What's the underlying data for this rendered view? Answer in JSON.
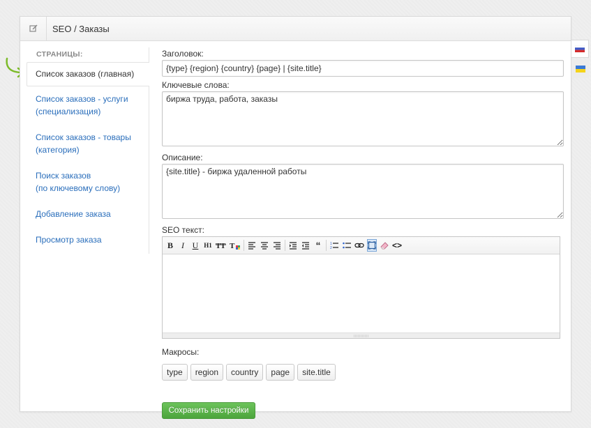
{
  "header": {
    "title": "SEO / Заказы",
    "icon": "edit-icon"
  },
  "sidebar": {
    "title": "СТРАНИЦЫ:",
    "active_item": "Список заказов (главная)",
    "items": [
      {
        "line1": "Список заказов - услуги",
        "line2": "(специализация)"
      },
      {
        "line1": "Список заказов - товары",
        "line2": "(категория)"
      },
      {
        "line1": "Поиск заказов",
        "line2": "(по ключевому слову)"
      },
      {
        "line1": "Добавление заказа",
        "line2": ""
      },
      {
        "line1": "Просмотр заказа",
        "line2": ""
      }
    ]
  },
  "form": {
    "title_label": "Заголовок:",
    "title_value": "{type} {region} {country} {page} | {site.title}",
    "keywords_label": "Ключевые слова:",
    "keywords_value": "биржа труда, работа, заказы",
    "description_label": "Описание:",
    "description_value": "{site.title} - биржа удаленной работы",
    "seo_text_label": "SEO текст:",
    "macros_label": "Макросы:",
    "macros": [
      "type",
      "region",
      "country",
      "page",
      "site.title"
    ],
    "save_label": "Сохранить настройки"
  },
  "toolbar": {
    "bold": "B",
    "italic": "I",
    "underline": "U",
    "heading": "H1",
    "quote": "“",
    "source": "<>"
  },
  "languages": [
    {
      "code": "ru",
      "icon": "russian-flag-icon"
    },
    {
      "code": "uk",
      "icon": "ukrainian-flag-icon"
    }
  ],
  "colors": {
    "link": "#2a6ebb",
    "save_button": "#5cb64a",
    "arrow": "#7dbb2a"
  }
}
